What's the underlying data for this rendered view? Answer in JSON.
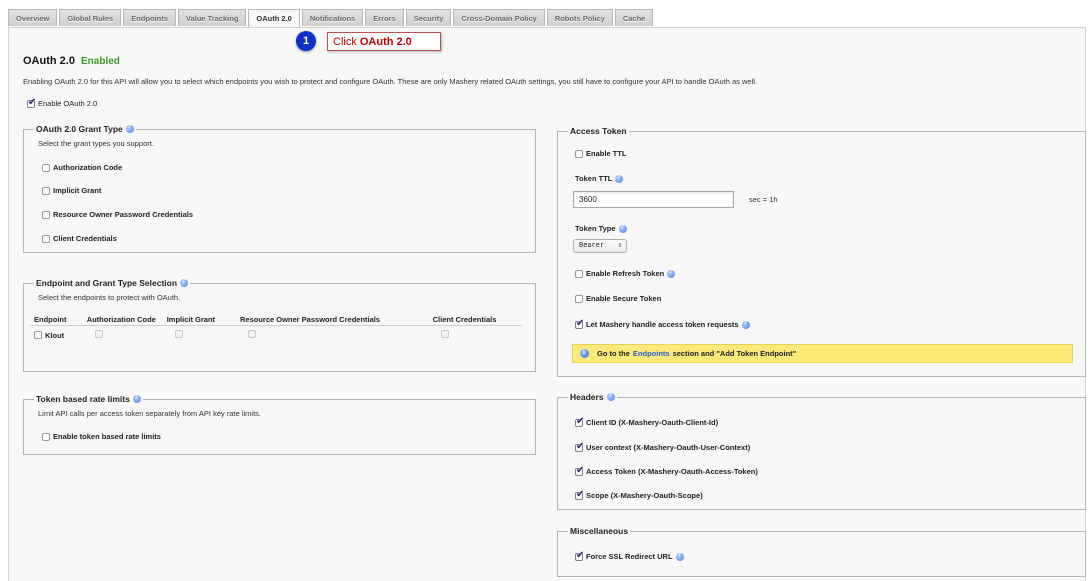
{
  "tabs": [
    "Overview",
    "Global Rules",
    "Endpoints",
    "Value Tracking",
    "OAuth 2.0",
    "Notifications",
    "Errors",
    "Security",
    "Cross-Domain Policy",
    "Robots Policy",
    "Cache"
  ],
  "active_tab": "OAuth 2.0",
  "callout": {
    "number": "1",
    "prefix": "Click",
    "target": "OAuth 2.0"
  },
  "page": {
    "title": "OAuth 2.0",
    "status": "Enabled",
    "intro": "Enabling OAuth 2.0 for this API will allow you to select which endpoints you wish to protect and configure OAuth. These are only Mashery related OAuth settings, you still have to configure your API to handle OAuth as well.",
    "enable_label": "Enable OAuth 2.0",
    "enable_checked": true
  },
  "grant_type": {
    "title": "OAuth 2.0 Grant Type",
    "subtitle": "Select the grant types you support.",
    "options": [
      {
        "label": "Authorization Code",
        "checked": false
      },
      {
        "label": "Implicit Grant",
        "checked": false
      },
      {
        "label": "Resource Owner Password Credentials",
        "checked": false
      },
      {
        "label": "Client Credentials",
        "checked": false
      }
    ]
  },
  "endpoint_selection": {
    "title": "Endpoint and Grant Type Selection",
    "subtitle": "Select the endpoints to protect with OAuth.",
    "columns": [
      "Endpoint",
      "Authorization Code",
      "Implicit Grant",
      "Resource Owner Password Credentials",
      "Client Credentials"
    ],
    "rows": [
      {
        "endpoint": "Klout"
      }
    ]
  },
  "rate_limits": {
    "title": "Token based rate limits",
    "subtitle": "Limit API calls per access token separately from API key rate limits.",
    "enable_label": "Enable token based rate limits",
    "enable_checked": false
  },
  "access_token": {
    "title": "Access Token",
    "enable_ttl_label": "Enable TTL",
    "enable_ttl_checked": false,
    "ttl_label": "Token TTL",
    "ttl_value": "3600",
    "ttl_hint": "sec = 1h",
    "type_label": "Token Type",
    "type_value": "Bearer",
    "refresh_label": "Enable Refresh Token",
    "refresh_checked": false,
    "secure_label": "Enable Secure Token",
    "secure_checked": false,
    "mashery_handle_label": "Let Mashery handle access token requests",
    "mashery_handle_checked": true,
    "notice_prefix": "Go to the",
    "notice_link": "Endpoints",
    "notice_suffix": "section and \"Add Token Endpoint\""
  },
  "headers": {
    "title": "Headers",
    "items": [
      {
        "label": "Client ID (X-Mashery-Oauth-Client-Id)",
        "checked": true
      },
      {
        "label": "User context (X-Mashery-Oauth-User-Context)",
        "checked": true
      },
      {
        "label": "Access Token (X-Mashery-Oauth-Access-Token)",
        "checked": true
      },
      {
        "label": "Scope (X-Mashery-Oauth-Scope)",
        "checked": true
      }
    ]
  },
  "misc": {
    "title": "Miscellaneous",
    "force_ssl_label": "Force SSL Redirect URL",
    "force_ssl_checked": true
  },
  "colors": {
    "enabled_green": "#3a9a2a",
    "callout_red": "#c00000",
    "callout_blue": "#1030c8",
    "notice_yellow": "#faea7a"
  }
}
